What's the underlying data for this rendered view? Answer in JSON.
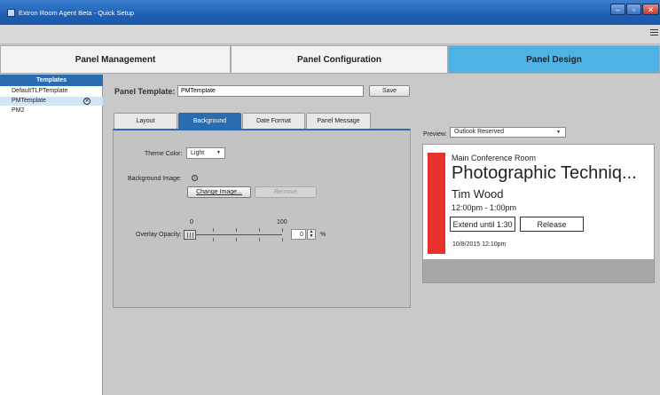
{
  "window": {
    "title": "Extron Room Agent Beta - Quick Setup"
  },
  "main_tabs": [
    {
      "label": "Panel Management"
    },
    {
      "label": "Panel Configuration"
    },
    {
      "label": "Panel Design"
    }
  ],
  "sidebar": {
    "header": "Templates",
    "items": [
      {
        "label": "DefaultTLPTemplate"
      },
      {
        "label": "PMTemplate"
      },
      {
        "label": "PM2"
      }
    ]
  },
  "template_row": {
    "label": "Panel Template:",
    "value": "PMTemplate",
    "save_label": "Save"
  },
  "sub_tabs": [
    {
      "label": "Layout"
    },
    {
      "label": "Background"
    },
    {
      "label": "Date Format"
    },
    {
      "label": "Panel Message"
    }
  ],
  "background": {
    "theme_color_label": "Theme Color:",
    "theme_color_value": "Light",
    "image_label": "Background Image:",
    "change_image_label": "Change Image...",
    "remove_label": "Remove",
    "overlay_label": "Overlay Opacity:",
    "slider_min": "0",
    "slider_max": "100",
    "opacity_value": "0",
    "opacity_unit": "%"
  },
  "preview": {
    "label": "Preview:",
    "selected": "Outlook Reserved",
    "room": "Main Conference Room",
    "meeting": "Photographic Techniq...",
    "organizer": "Tim Wood",
    "time": "12:00pm - 1:00pm",
    "extend_label": "Extend until 1:30",
    "release_label": "Release",
    "datetime": "10/8/2015  12:10pm",
    "accent_color": "#e8302c"
  },
  "colors": {
    "accent": "#2a6cb0",
    "active_tab": "#4fb2e4"
  }
}
